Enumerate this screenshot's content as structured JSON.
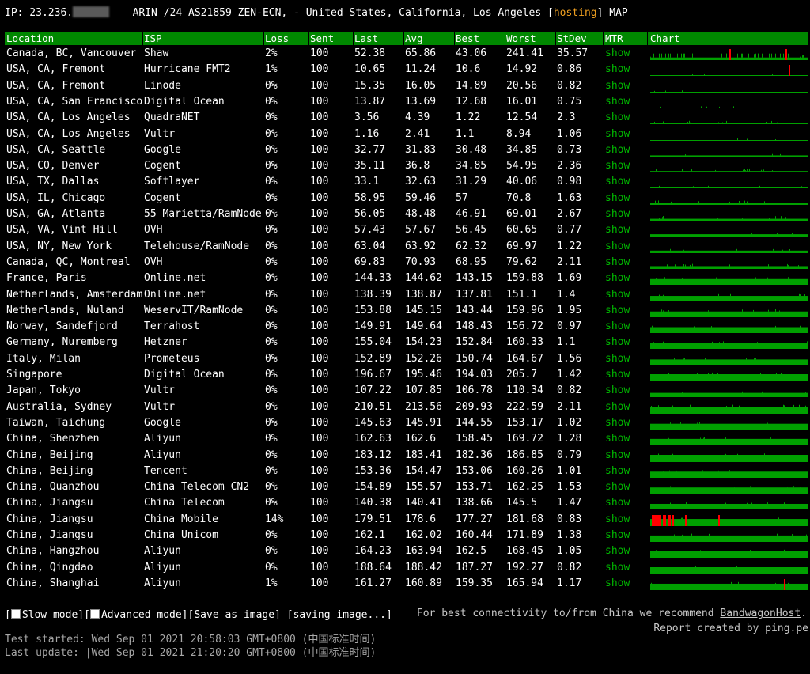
{
  "header": {
    "ip_label": "IP: 23.236.",
    "info": " – ARIN /24 ",
    "asn": "AS21859",
    "org_loc": " ZEN-ECN, - United States, California, Los Angeles ",
    "bracket_open": "[",
    "hosting": "hosting",
    "bracket_close": "]",
    "map": "MAP"
  },
  "table": {
    "columns": [
      "Location",
      "ISP",
      "Loss",
      "Sent",
      "Last",
      "Avg",
      "Best",
      "Worst",
      "StDev",
      "MTR",
      "Chart"
    ],
    "rows": [
      [
        "Canada, BC, Vancouver",
        "Shaw",
        "2%",
        "100",
        "52.38",
        "65.86",
        "43.06",
        "241.41",
        "35.57",
        "show"
      ],
      [
        "USA, CA, Fremont",
        "Hurricane FMT2",
        "1%",
        "100",
        "10.65",
        "11.24",
        "10.6",
        "14.92",
        "0.86",
        "show"
      ],
      [
        "USA, CA, Fremont",
        "Linode",
        "0%",
        "100",
        "15.35",
        "16.05",
        "14.89",
        "20.56",
        "0.82",
        "show"
      ],
      [
        "USA, CA, San Francisco",
        "Digital Ocean",
        "0%",
        "100",
        "13.87",
        "13.69",
        "12.68",
        "16.01",
        "0.75",
        "show"
      ],
      [
        "USA, CA, Los Angeles",
        "QuadraNET",
        "0%",
        "100",
        "3.56",
        "4.39",
        "1.22",
        "12.54",
        "2.3",
        "show"
      ],
      [
        "USA, CA, Los Angeles",
        "Vultr",
        "0%",
        "100",
        "1.16",
        "2.41",
        "1.1",
        "8.94",
        "1.06",
        "show"
      ],
      [
        "USA, CA, Seattle",
        "Google",
        "0%",
        "100",
        "32.77",
        "31.83",
        "30.48",
        "34.85",
        "0.73",
        "show"
      ],
      [
        "USA, CO, Denver",
        "Cogent",
        "0%",
        "100",
        "35.11",
        "36.8",
        "34.85",
        "54.95",
        "2.36",
        "show"
      ],
      [
        "USA, TX, Dallas",
        "Softlayer",
        "0%",
        "100",
        "33.1",
        "32.63",
        "31.29",
        "40.06",
        "0.98",
        "show"
      ],
      [
        "USA, IL, Chicago",
        "Cogent",
        "0%",
        "100",
        "58.95",
        "59.46",
        "57",
        "70.8",
        "1.63",
        "show"
      ],
      [
        "USA, GA, Atlanta",
        "55 Marietta/RamNode",
        "0%",
        "100",
        "56.05",
        "48.48",
        "46.91",
        "69.01",
        "2.67",
        "show"
      ],
      [
        "USA, VA, Vint Hill",
        "OVH",
        "0%",
        "100",
        "57.43",
        "57.67",
        "56.45",
        "60.65",
        "0.77",
        "show"
      ],
      [
        "USA, NY, New York",
        "Telehouse/RamNode",
        "0%",
        "100",
        "63.04",
        "63.92",
        "62.32",
        "69.97",
        "1.22",
        "show"
      ],
      [
        "Canada, QC, Montreal",
        "OVH",
        "0%",
        "100",
        "69.83",
        "70.93",
        "68.95",
        "79.62",
        "2.11",
        "show"
      ],
      [
        "France, Paris",
        "Online.net",
        "0%",
        "100",
        "144.33",
        "144.62",
        "143.15",
        "159.88",
        "1.69",
        "show"
      ],
      [
        "Netherlands, Amsterdam",
        "Online.net",
        "0%",
        "100",
        "138.39",
        "138.87",
        "137.81",
        "151.1",
        "1.4",
        "show"
      ],
      [
        "Netherlands, Nuland",
        "WeservIT/RamNode",
        "0%",
        "100",
        "153.88",
        "145.15",
        "143.44",
        "159.96",
        "1.95",
        "show"
      ],
      [
        "Norway, Sandefjord",
        "Terrahost",
        "0%",
        "100",
        "149.91",
        "149.64",
        "148.43",
        "156.72",
        "0.97",
        "show"
      ],
      [
        "Germany, Nuremberg",
        "Hetzner",
        "0%",
        "100",
        "155.04",
        "154.23",
        "152.84",
        "160.33",
        "1.1",
        "show"
      ],
      [
        "Italy, Milan",
        "Prometeus",
        "0%",
        "100",
        "152.89",
        "152.26",
        "150.74",
        "164.67",
        "1.56",
        "show"
      ],
      [
        "Singapore",
        "Digital Ocean",
        "0%",
        "100",
        "196.67",
        "195.46",
        "194.03",
        "205.7",
        "1.42",
        "show"
      ],
      [
        "Japan, Tokyo",
        "Vultr",
        "0%",
        "100",
        "107.22",
        "107.85",
        "106.78",
        "110.34",
        "0.82",
        "show"
      ],
      [
        "Australia, Sydney",
        "Vultr",
        "0%",
        "100",
        "210.51",
        "213.56",
        "209.93",
        "222.59",
        "2.11",
        "show"
      ],
      [
        "Taiwan, Taichung",
        "Google",
        "0%",
        "100",
        "145.63",
        "145.91",
        "144.55",
        "153.17",
        "1.02",
        "show"
      ],
      [
        "China, Shenzhen",
        "Aliyun",
        "0%",
        "100",
        "162.63",
        "162.6",
        "158.45",
        "169.72",
        "1.28",
        "show"
      ],
      [
        "China, Beijing",
        "Aliyun",
        "0%",
        "100",
        "183.12",
        "183.41",
        "182.36",
        "186.85",
        "0.79",
        "show"
      ],
      [
        "China, Beijing",
        "Tencent",
        "0%",
        "100",
        "153.36",
        "154.47",
        "153.06",
        "160.26",
        "1.01",
        "show"
      ],
      [
        "China, Quanzhou",
        "China Telecom CN2",
        "0%",
        "100",
        "154.89",
        "155.57",
        "153.71",
        "162.25",
        "1.53",
        "show"
      ],
      [
        "China, Jiangsu",
        "China Telecom",
        "0%",
        "100",
        "140.38",
        "140.41",
        "138.66",
        "145.5",
        "1.47",
        "show"
      ],
      [
        "China, Jiangsu",
        "China Mobile",
        "14%",
        "100",
        "179.51",
        "178.6",
        "177.27",
        "181.68",
        "0.83",
        "show"
      ],
      [
        "China, Jiangsu",
        "China Unicom",
        "0%",
        "100",
        "162.1",
        "162.02",
        "160.44",
        "171.89",
        "1.38",
        "show"
      ],
      [
        "China, Hangzhou",
        "Aliyun",
        "0%",
        "100",
        "164.23",
        "163.94",
        "162.5",
        "168.45",
        "1.05",
        "show"
      ],
      [
        "China, Qingdao",
        "Aliyun",
        "0%",
        "100",
        "188.64",
        "188.42",
        "187.27",
        "192.27",
        "0.82",
        "show"
      ],
      [
        "China, Shanghai",
        "Aliyun",
        "1%",
        "100",
        "161.27",
        "160.89",
        "159.35",
        "165.94",
        "1.17",
        "show"
      ]
    ],
    "loss_markers": {
      "0": [
        0.5,
        0.86
      ],
      "1": [
        0.88
      ],
      "29": [
        0.01,
        0.02,
        0.03,
        0.04,
        0.05,
        0.06,
        0.08,
        0.09,
        0.11,
        0.12,
        0.14,
        0.22,
        0.43
      ],
      "33": [
        0.85
      ]
    }
  },
  "colors": {
    "header_bg": "#008800",
    "chart_green": "#00a000",
    "loss_red": "#ff0000",
    "mtr_link": "#00b800"
  },
  "options": {
    "open": "[",
    "slow": "Slow mode]",
    "open2": "[",
    "advanced": "Advanced mode]",
    "save_open": "[",
    "save": "Save as image",
    "save_close": "]",
    "saving": " [saving image...]"
  },
  "recommend": {
    "text": "For best connectivity to/from China we recommend ",
    "link": "BandwagonHost",
    "dot": ".",
    "report": "Report created by ping.pe"
  },
  "times": {
    "started": "Test started: Wed Sep 01 2021 20:58:03 GMT+0800 (中国标准时间)",
    "updated": "Last update: |Wed Sep 01 2021 21:20:20 GMT+0800 (中国标准时间)"
  }
}
